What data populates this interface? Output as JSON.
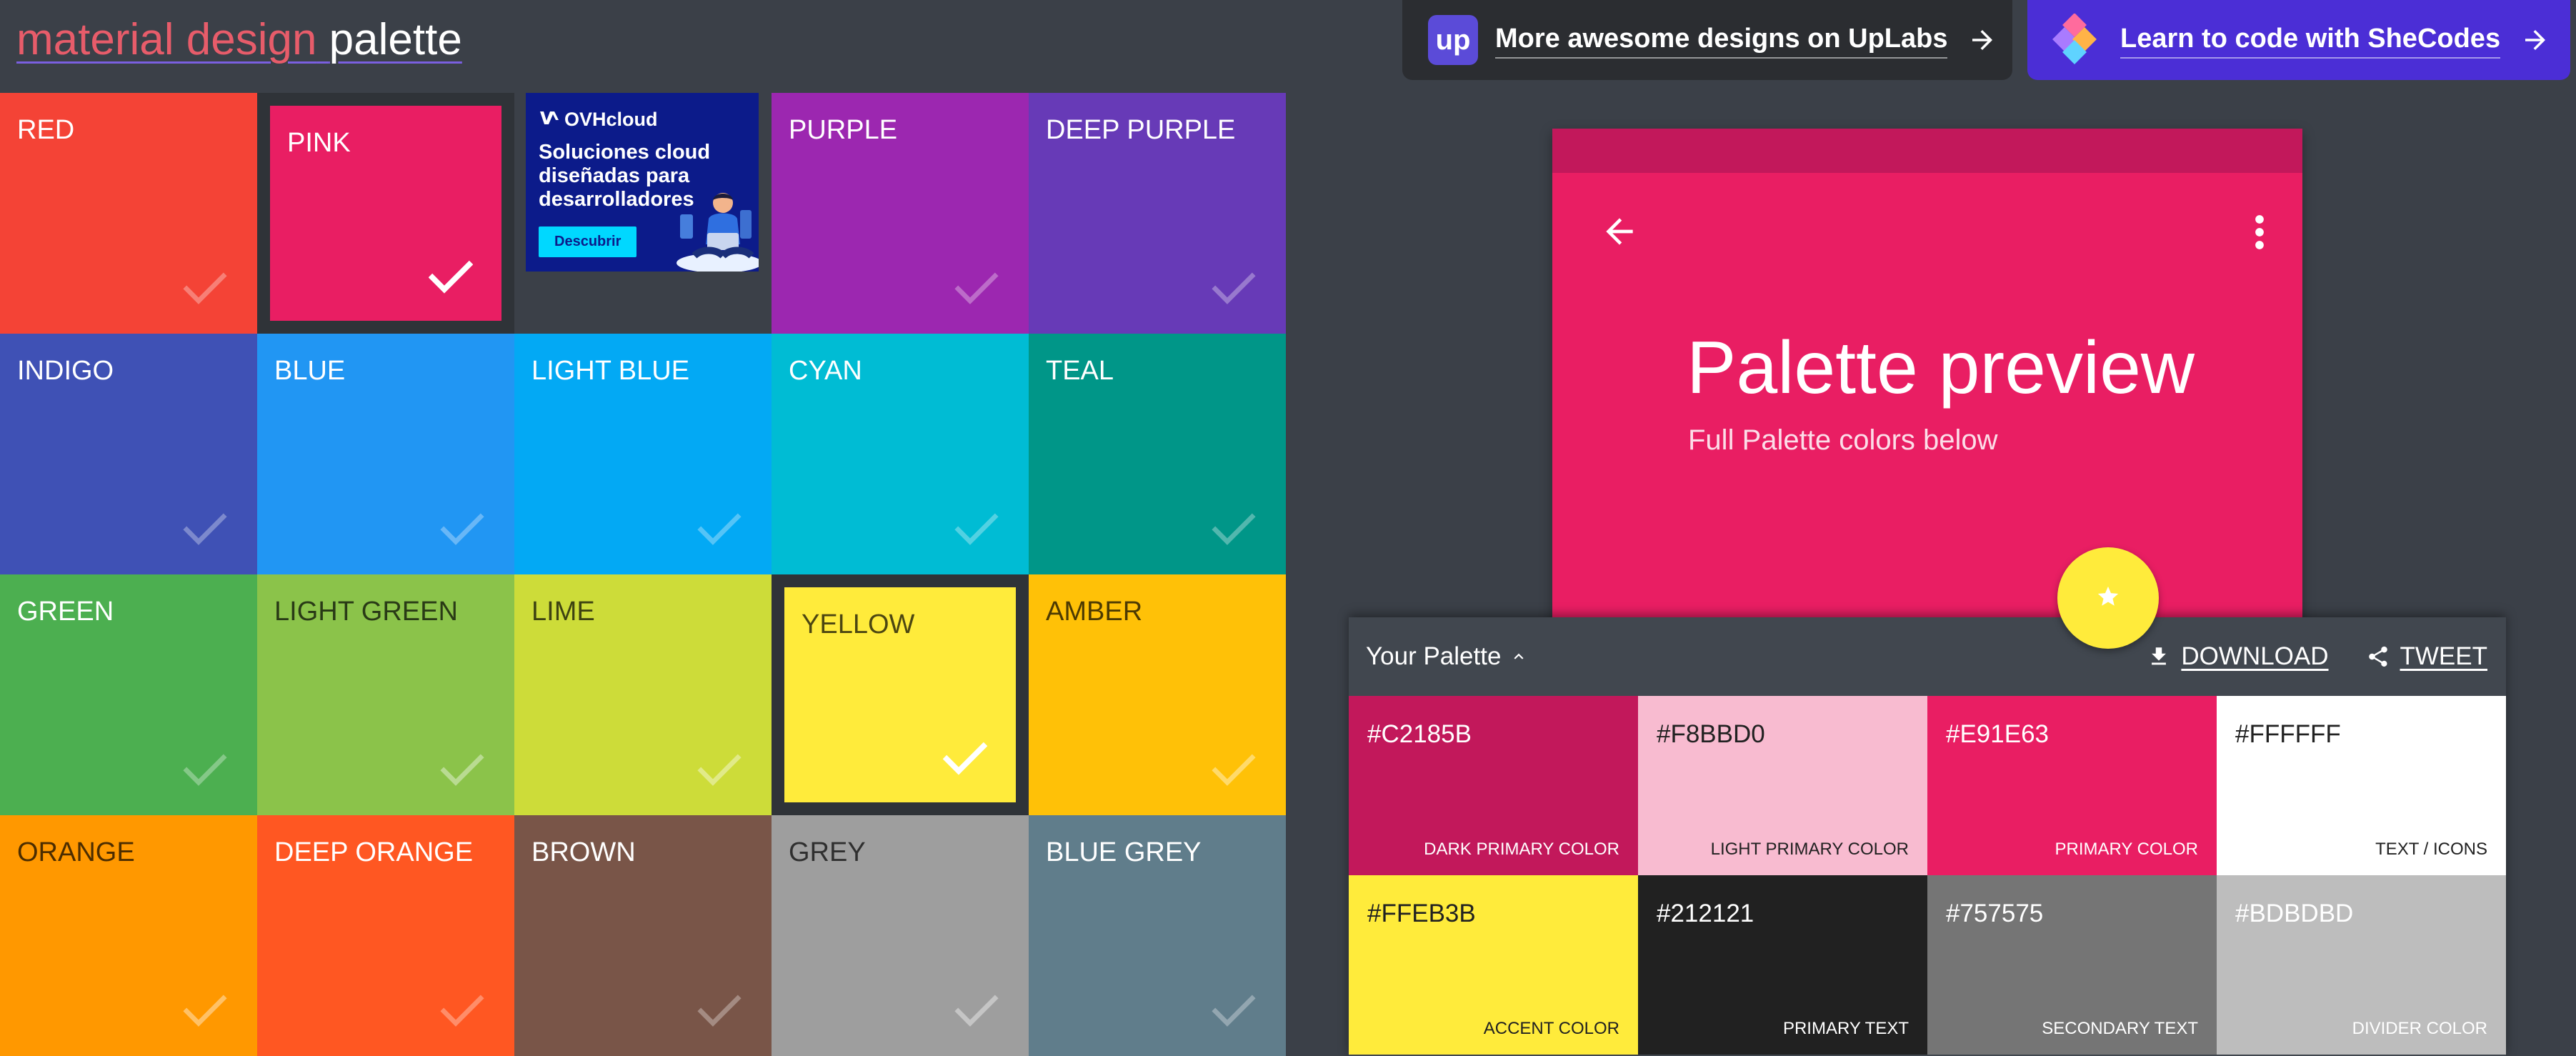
{
  "header": {
    "logo_word1": "material design",
    "logo_word2": "palette",
    "promo_uplabs": {
      "logo_text": "up",
      "label": "More awesome designs on UpLabs"
    },
    "promo_shecodes": {
      "label": "Learn to code with SheCodes"
    }
  },
  "colors": [
    {
      "label": "RED",
      "bg": "#f44336",
      "text": "light"
    },
    {
      "label": "PINK",
      "bg": "#e91e63",
      "text": "light",
      "selected": true
    },
    {
      "ad": true
    },
    {
      "label": "PURPLE",
      "bg": "#9c27b0",
      "text": "light"
    },
    {
      "label": "DEEP PURPLE",
      "bg": "#673ab7",
      "text": "light"
    },
    {
      "label": "INDIGO",
      "bg": "#3f51b5",
      "text": "light"
    },
    {
      "label": "BLUE",
      "bg": "#2196f3",
      "text": "light"
    },
    {
      "label": "LIGHT BLUE",
      "bg": "#03a9f4",
      "text": "light"
    },
    {
      "label": "CYAN",
      "bg": "#00bcd4",
      "text": "light"
    },
    {
      "label": "TEAL",
      "bg": "#009688",
      "text": "light"
    },
    {
      "label": "GREEN",
      "bg": "#4caf50",
      "text": "light"
    },
    {
      "label": "LIGHT GREEN",
      "bg": "#8bc34a",
      "text": "dark"
    },
    {
      "label": "LIME",
      "bg": "#cddc39",
      "text": "dark"
    },
    {
      "label": "YELLOW",
      "bg": "#ffeb3b",
      "text": "dark",
      "selected": true
    },
    {
      "label": "AMBER",
      "bg": "#ffc107",
      "text": "dark"
    },
    {
      "label": "ORANGE",
      "bg": "#ff9800",
      "text": "dark"
    },
    {
      "label": "DEEP ORANGE",
      "bg": "#ff5722",
      "text": "light"
    },
    {
      "label": "BROWN",
      "bg": "#795548",
      "text": "light"
    },
    {
      "label": "GREY",
      "bg": "#9e9e9e",
      "text": "dark"
    },
    {
      "label": "BLUE GREY",
      "bg": "#607d8b",
      "text": "light"
    }
  ],
  "ad": {
    "brand": "OVHcloud",
    "headline": "Soluciones cloud diseñadas para desarrolladores",
    "cta": "Descubrir"
  },
  "preview": {
    "title": "Palette preview",
    "subtitle": "Full Palette colors below",
    "primary_color": "#e91e63",
    "dark_primary_color": "#c2185b",
    "accent_color": "#ffeb3b",
    "icons": [
      "arrow-back-icon",
      "more-vert-icon",
      "star-icon"
    ]
  },
  "palette": {
    "title": "Your Palette",
    "download_label": "DOWNLOAD",
    "tweet_label": "TWEET",
    "swatches": [
      {
        "hex": "#C2185B",
        "name": "DARK PRIMARY COLOR",
        "bg": "#c2185b",
        "text": "light"
      },
      {
        "hex": "#F8BBD0",
        "name": "LIGHT PRIMARY COLOR",
        "bg": "#f8bbd0",
        "text": "dark"
      },
      {
        "hex": "#E91E63",
        "name": "PRIMARY COLOR",
        "bg": "#e91e63",
        "text": "light"
      },
      {
        "hex": "#FFFFFF",
        "name": "TEXT / ICONS",
        "bg": "#ffffff",
        "text": "dark"
      },
      {
        "hex": "#FFEB3B",
        "name": "ACCENT COLOR",
        "bg": "#ffeb3b",
        "text": "dark"
      },
      {
        "hex": "#212121",
        "name": "PRIMARY TEXT",
        "bg": "#212121",
        "text": "light"
      },
      {
        "hex": "#757575",
        "name": "SECONDARY TEXT",
        "bg": "#757575",
        "text": "light"
      },
      {
        "hex": "#BDBDBD",
        "name": "DIVIDER COLOR",
        "bg": "#bdbdbd",
        "text": "light"
      }
    ]
  }
}
